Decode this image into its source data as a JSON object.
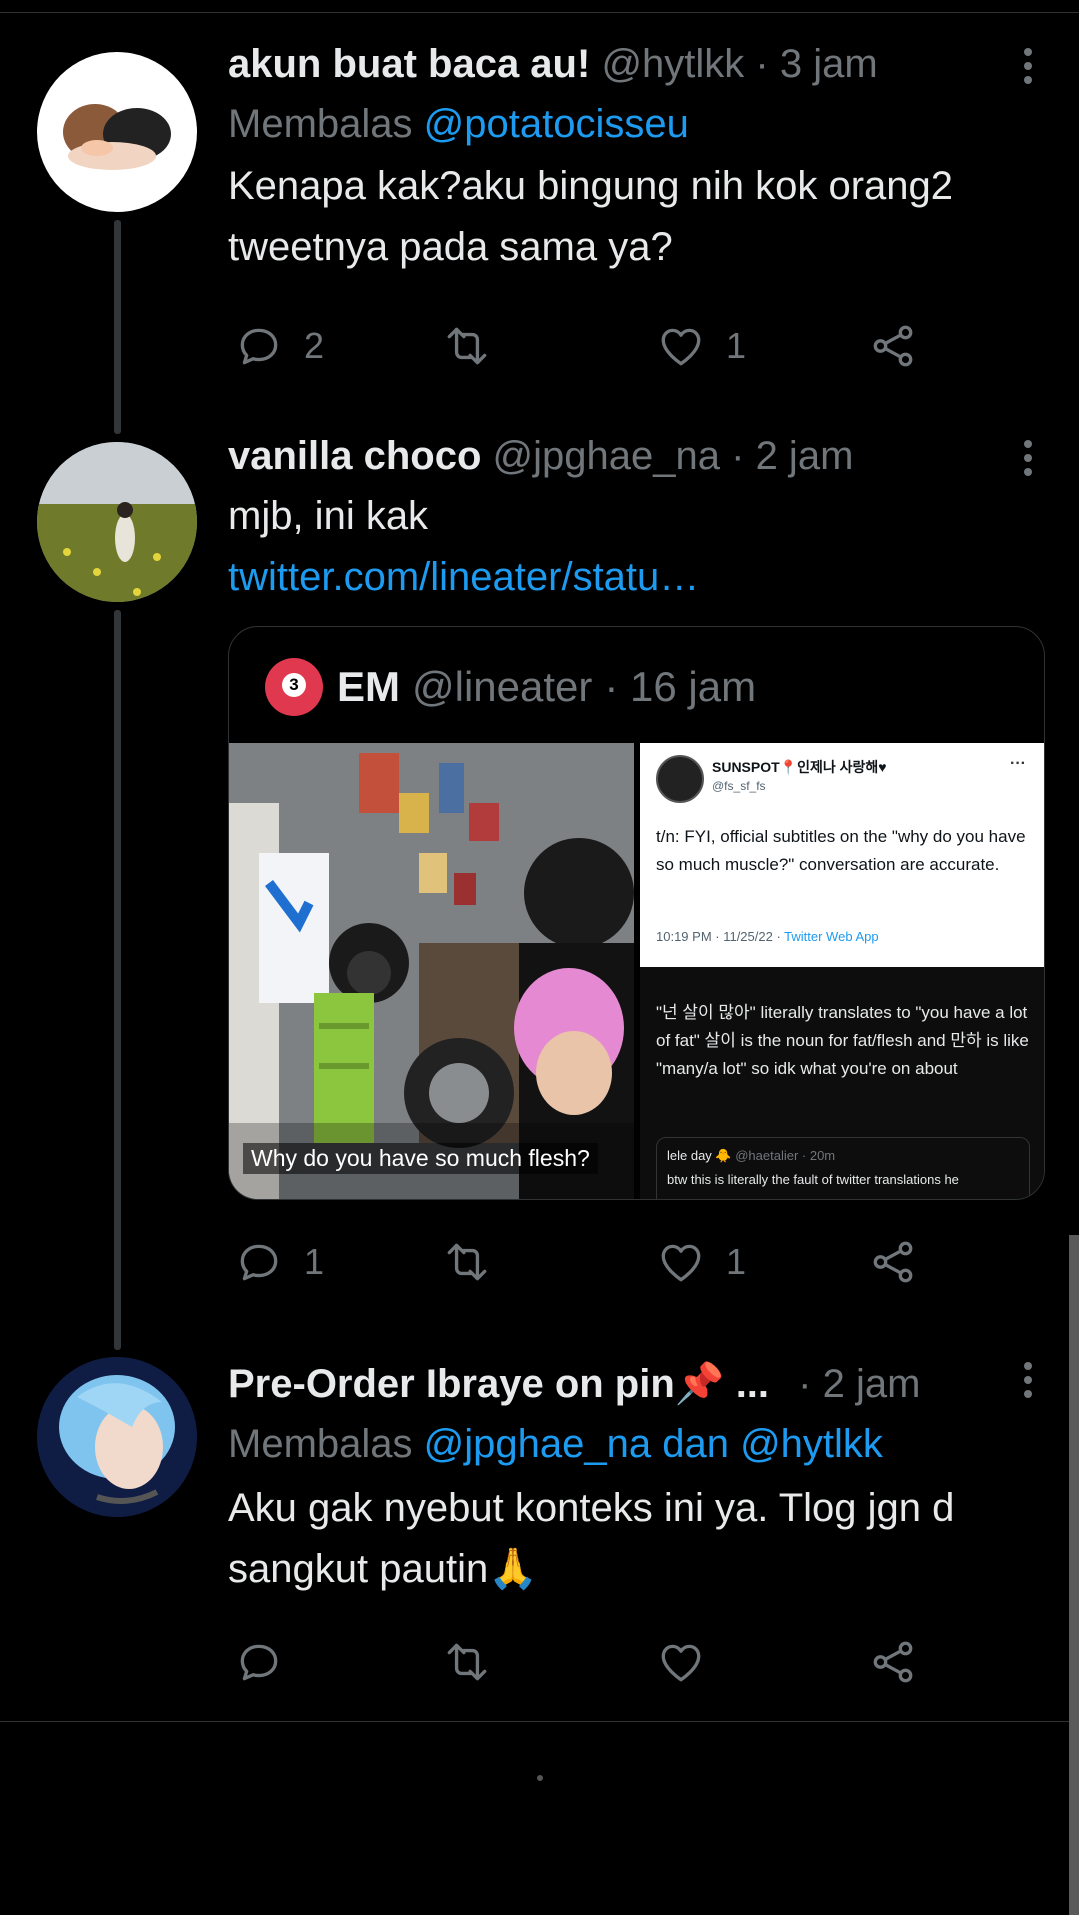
{
  "tweets": [
    {
      "display_name": "akun buat baca au!",
      "handle": "@hytlkk",
      "time": "· 3 jam",
      "reply_prefix": "Membalas",
      "reply_to": "@potatocisseu",
      "text_line1": "Kenapa kak?aku bingung nih kok orang2",
      "text_line2": "tweetnya pada sama ya?",
      "reply_count": "2",
      "retweet_count": "",
      "like_count": "1"
    },
    {
      "display_name": "vanilla choco",
      "handle": "@jpghae_na",
      "time": "· 2 jam",
      "text": "mjb, ini kak",
      "link": "twitter.com/lineater/statu…",
      "reply_count": "1",
      "retweet_count": "",
      "like_count": "1",
      "quote": {
        "display_name": "EM",
        "handle": "@lineater",
        "time": "· 16 jam",
        "video_caption": "Why do you have so much flesh?",
        "screenshot": {
          "name": "SUNSPOT📍인제나 사랑해♥",
          "handle": "@fs_sf_fs",
          "more": "···",
          "body": "t/n: FYI, official subtitles on the \"why do you have so much muscle?\" conversation are accurate.",
          "meta_time": "10:19 PM · 11/25/22 · ",
          "meta_app": "Twitter Web App",
          "body2": "\"넌 살이 많아\" literally translates to \"you have a lot of fat\" 살이 is the noun for fat/flesh and 만하 is like \"many/a lot\" so idk what you're on about",
          "quoted_name": "lele day 🐥",
          "quoted_handle": "@haetalier · 20m",
          "quoted_text": "btw this is literally the fault of twitter translations he"
        }
      }
    },
    {
      "display_name": "Pre-Order Ibraye on pin📌 ...",
      "time": "· 2 jam",
      "reply_prefix": "Membalas",
      "reply_to": "@jpghae_na dan @hytlkk",
      "text_line1": "Aku gak nyebut konteks ini ya. Tlog jgn d",
      "text_line2": "sangkut pautin🙏",
      "reply_count": "",
      "retweet_count": "",
      "like_count": ""
    }
  ],
  "icons": [
    "more-icon",
    "reply-icon",
    "retweet-icon",
    "like-icon",
    "share-icon"
  ],
  "colors": {
    "background": "#000000",
    "link": "#1d9bf0",
    "muted": "#71767b",
    "text": "#e7e9ea"
  }
}
